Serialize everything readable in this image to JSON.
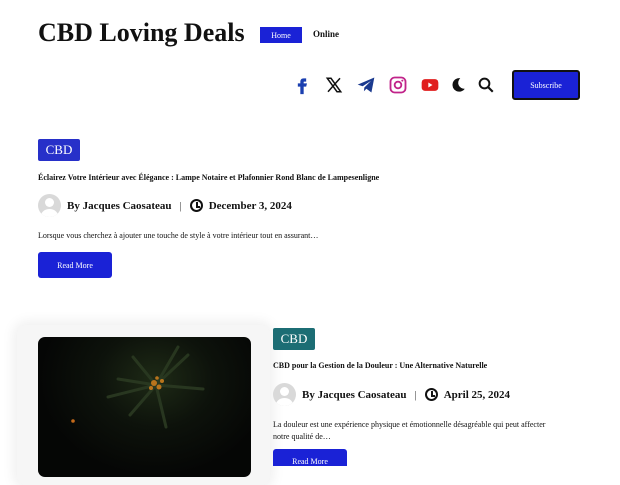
{
  "site": {
    "title": "CBD Loving Deals"
  },
  "nav": {
    "items": [
      {
        "label": "Home"
      },
      {
        "label": "Online"
      }
    ]
  },
  "header": {
    "social_icons": [
      "facebook-icon",
      "x-icon",
      "telegram-icon",
      "instagram-icon",
      "youtube-icon"
    ],
    "subscribe_label": "Subscribe"
  },
  "colors": {
    "accent": "#1a22d6",
    "category_primary": "#2730c9",
    "category_secondary": "#1c6d74"
  },
  "posts": [
    {
      "category": "CBD",
      "title": "Éclairez Votre Intérieur avec Élégance : Lampe Notaire et Plafonnier Rond Blanc de Lampesenligne",
      "author": "By Jacques Caosateau",
      "date": "December 3, 2024",
      "excerpt": "Lorsque vous cherchez à ajouter une touche de style à votre intérieur tout en assurant…",
      "read_more": "Read More"
    },
    {
      "category": "CBD",
      "title": "CBD pour la Gestion de la Douleur : Une Alternative Naturelle",
      "author": "By Jacques Caosateau",
      "date": "April 25, 2024",
      "excerpt_line1": "La douleur est une expérience physique et émotionnelle désagréable qui peut affecter",
      "excerpt_line2": "notre qualité de…",
      "read_more": "Read More"
    }
  ]
}
